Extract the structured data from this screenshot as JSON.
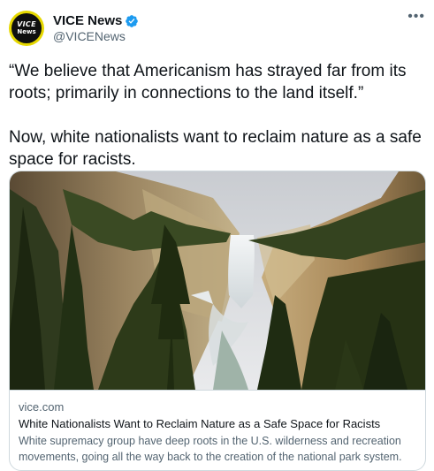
{
  "author": {
    "display_name": "VICE News",
    "handle": "@VICENews",
    "verified": true,
    "avatar_line1": "VICE",
    "avatar_line2": "News"
  },
  "more_icon": "more-horizontal-icon",
  "tweet": {
    "paragraph1": "“We believe that Americanism has strayed far from its roots; primarily in connections to the land itself.”",
    "paragraph2": "Now, white nationalists want to reclaim nature as a safe space for racists."
  },
  "card": {
    "domain": "vice.com",
    "title": "White Nationalists Want to Reclaim Nature as a Safe Space for Racists",
    "description": "White supremacy group have deep roots in the U.S. wilderness and recreation movements, going all the way back to the creation of the national park system.",
    "image_alt": "waterfall canyon photo"
  },
  "colors": {
    "verified_blue": "#1d9bf0",
    "avatar_yellow": "#e6d800",
    "secondary_text": "#536471",
    "border": "#cfd9de"
  }
}
